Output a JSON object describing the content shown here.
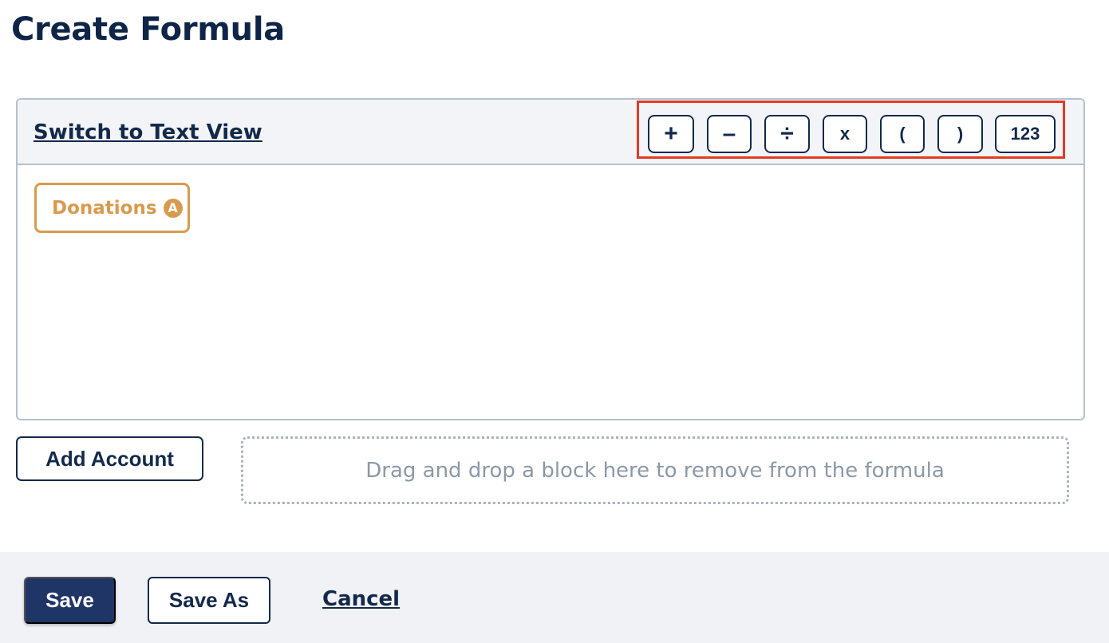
{
  "page": {
    "title": "Create Formula"
  },
  "editor": {
    "switch_view_label": "Switch to Text View",
    "operators": [
      {
        "label": "+",
        "icon": "plus-icon"
      },
      {
        "label": "–",
        "icon": "minus-icon"
      },
      {
        "label": "÷",
        "icon": "divide-icon"
      },
      {
        "label": "x",
        "icon": "multiply-icon"
      },
      {
        "label": "(",
        "icon": "open-paren-icon"
      },
      {
        "label": ")",
        "icon": "close-paren-icon"
      },
      {
        "label": "123",
        "icon": "number-icon"
      }
    ],
    "blocks": [
      {
        "label": "Donations",
        "badge": "A"
      }
    ]
  },
  "actions": {
    "add_account_label": "Add Account",
    "drop_zone_text": "Drag and drop a block here to remove from the formula"
  },
  "footer": {
    "save_label": "Save",
    "save_as_label": "Save As",
    "cancel_label": "Cancel"
  },
  "colors": {
    "primary": "#13294b",
    "highlight_border": "#e53a24",
    "block_accent": "#d99a4e",
    "save_button": "#1f3566"
  }
}
